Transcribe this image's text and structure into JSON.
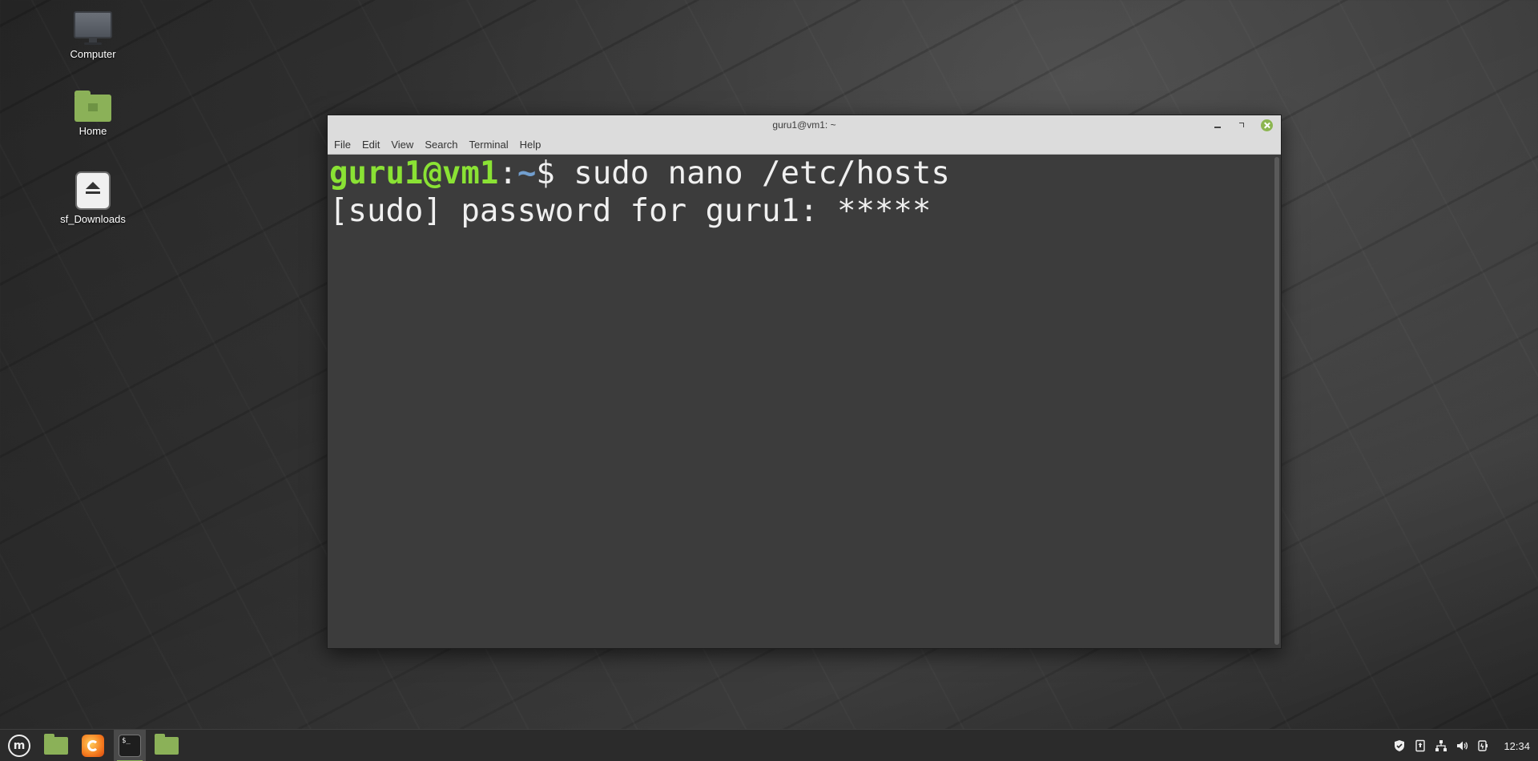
{
  "desktop": {
    "icons": [
      {
        "label": "Computer",
        "icon": "computer-icon"
      },
      {
        "label": "Home",
        "icon": "home-folder-icon"
      },
      {
        "label": "sf_Downloads",
        "icon": "eject-drive-icon"
      }
    ]
  },
  "window": {
    "title": "guru1@vm1: ~",
    "menu": [
      "File",
      "Edit",
      "View",
      "Search",
      "Terminal",
      "Help"
    ],
    "terminal": {
      "prompt_user": "guru1@vm1",
      "prompt_colon": ":",
      "prompt_path": "~",
      "prompt_symbol": "$",
      "command": " sudo nano /etc/hosts",
      "line2": "[sudo] password for guru1: *****"
    }
  },
  "taskbar": {
    "items": [
      "menu-icon",
      "files-icon",
      "firefox-icon",
      "terminal-icon",
      "files-icon"
    ],
    "terminal_glyph": "$_",
    "menu_glyph": "m",
    "clock": "12:34"
  },
  "colors": {
    "prompt_user": "#8ae234",
    "prompt_path": "#729fcf",
    "accent": "#8bb158"
  }
}
